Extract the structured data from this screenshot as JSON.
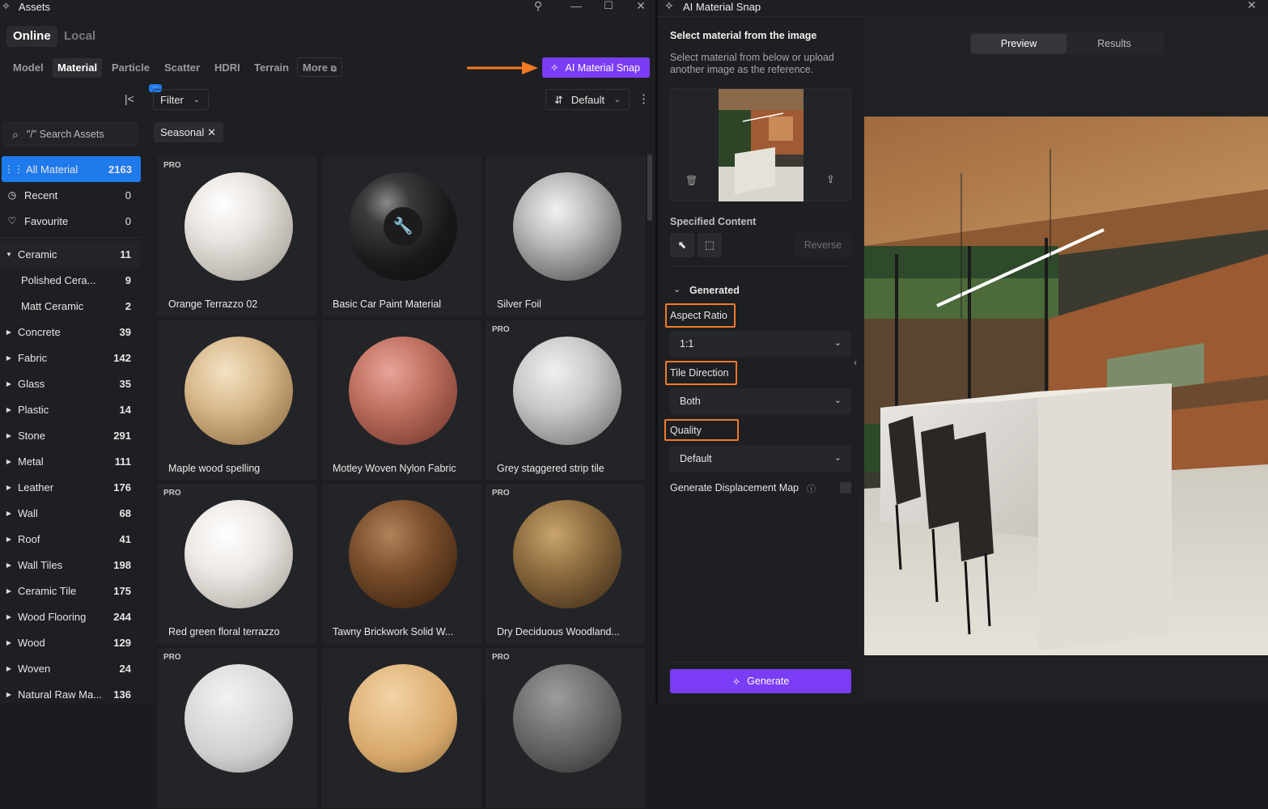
{
  "assets_window": {
    "title": "Assets",
    "source_tabs": [
      "Online",
      "Local"
    ],
    "category_tabs": [
      "Model",
      "Material",
      "Particle",
      "Scatter",
      "HDRI",
      "Terrain",
      "More"
    ],
    "active_category": "Material",
    "ai_button_label": "AI Material Snap",
    "filter_label": "Filter",
    "sort_label": "Default",
    "search_placeholder": "\"/\" Search Assets",
    "filter_chip": "Seasonal",
    "sidebar": {
      "quick": [
        {
          "label": "All Material",
          "count": "2163",
          "icon": "grid-icon"
        },
        {
          "label": "Recent",
          "count": "0",
          "icon": "clock-icon"
        },
        {
          "label": "Favourite",
          "count": "0",
          "icon": "heart-icon"
        }
      ],
      "tree": [
        {
          "label": "Ceramic",
          "count": "11",
          "expanded": true
        },
        {
          "label": "Polished Cera...",
          "count": "9",
          "child": true
        },
        {
          "label": "Matt Ceramic",
          "count": "2",
          "child": true
        },
        {
          "label": "Concrete",
          "count": "39"
        },
        {
          "label": "Fabric",
          "count": "142"
        },
        {
          "label": "Glass",
          "count": "35"
        },
        {
          "label": "Plastic",
          "count": "14"
        },
        {
          "label": "Stone",
          "count": "291"
        },
        {
          "label": "Metal",
          "count": "111"
        },
        {
          "label": "Leather",
          "count": "176"
        },
        {
          "label": "Wall",
          "count": "68"
        },
        {
          "label": "Roof",
          "count": "41"
        },
        {
          "label": "Wall Tiles",
          "count": "198"
        },
        {
          "label": "Ceramic Tile",
          "count": "175"
        },
        {
          "label": "Wood Flooring",
          "count": "244"
        },
        {
          "label": "Wood",
          "count": "129"
        },
        {
          "label": "Woven",
          "count": "24"
        },
        {
          "label": "Natural Raw Ma...",
          "count": "136"
        }
      ]
    },
    "materials": [
      {
        "name": "Orange Terrazzo 02",
        "pro": true
      },
      {
        "name": "Basic Car Paint Material",
        "pro": false
      },
      {
        "name": "Silver Foil",
        "pro": false
      },
      {
        "name": "Maple wood spelling",
        "pro": false
      },
      {
        "name": "Motley Woven Nylon Fabric",
        "pro": false
      },
      {
        "name": "Grey staggered strip tile",
        "pro": true
      },
      {
        "name": "Red green floral terrazzo",
        "pro": true
      },
      {
        "name": "Tawny Brickwork Solid W...",
        "pro": false
      },
      {
        "name": "Dry Deciduous Woodland...",
        "pro": true
      },
      {
        "name": "",
        "pro": true
      },
      {
        "name": "",
        "pro": false
      },
      {
        "name": "",
        "pro": true
      }
    ],
    "pro_badge": "PRO"
  },
  "snap_window": {
    "title": "AI Material Snap",
    "heading": "Select material from the image",
    "description": "Select material from below or upload another image as the reference.",
    "specified_content": "Specified Content",
    "reverse_label": "Reverse",
    "generated_label": "Generated",
    "aspect_ratio_label": "Aspect Ratio",
    "aspect_ratio_value": "1:1",
    "tile_direction_label": "Tile Direction",
    "tile_direction_value": "Both",
    "quality_label": "Quality",
    "quality_value": "Default",
    "displacement_label": "Generate Displacement Map",
    "generate_label": "Generate",
    "view_tabs": [
      "Preview",
      "Results"
    ],
    "active_view": "Preview"
  },
  "colors": {
    "accent": "#7b3cf5",
    "highlight": "#f07a2a",
    "selected": "#1f7aec"
  }
}
